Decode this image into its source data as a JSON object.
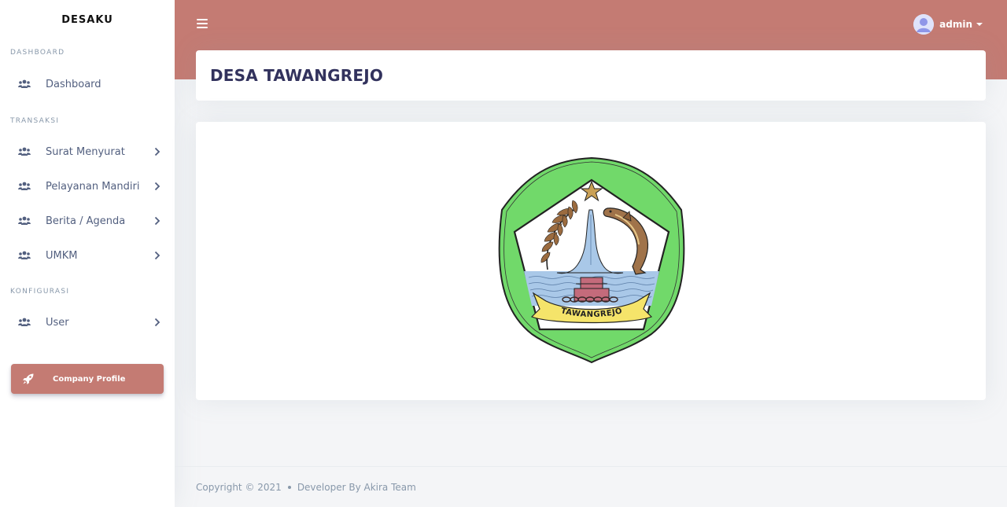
{
  "brand": "DESAKU",
  "sidebar": {
    "sections": [
      {
        "heading": "DASHBOARD",
        "items": [
          {
            "label": "Dashboard",
            "icon": "users-icon",
            "has_submenu": false
          }
        ]
      },
      {
        "heading": "TRANSAKSI",
        "items": [
          {
            "label": "Surat Menyurat",
            "icon": "users-icon",
            "has_submenu": true
          },
          {
            "label": "Pelayanan Mandiri",
            "icon": "users-icon",
            "has_submenu": true
          },
          {
            "label": "Berita / Agenda",
            "icon": "users-icon",
            "has_submenu": true
          },
          {
            "label": "UMKM",
            "icon": "users-icon",
            "has_submenu": true
          }
        ]
      },
      {
        "heading": "KONFIGURASI",
        "items": [
          {
            "label": "User",
            "icon": "users-icon",
            "has_submenu": true
          }
        ]
      }
    ],
    "cta": {
      "label": "Company Profile",
      "icon": "rocket-icon"
    }
  },
  "topbar": {
    "user_name": "admin",
    "accent_color": "#c47b73"
  },
  "page": {
    "title": "DESA TAWANGREJO",
    "emblem_text": "TAWANGREJO"
  },
  "footer": {
    "copyright": "Copyright © 2021",
    "developer": "Developer By Akira Team"
  }
}
